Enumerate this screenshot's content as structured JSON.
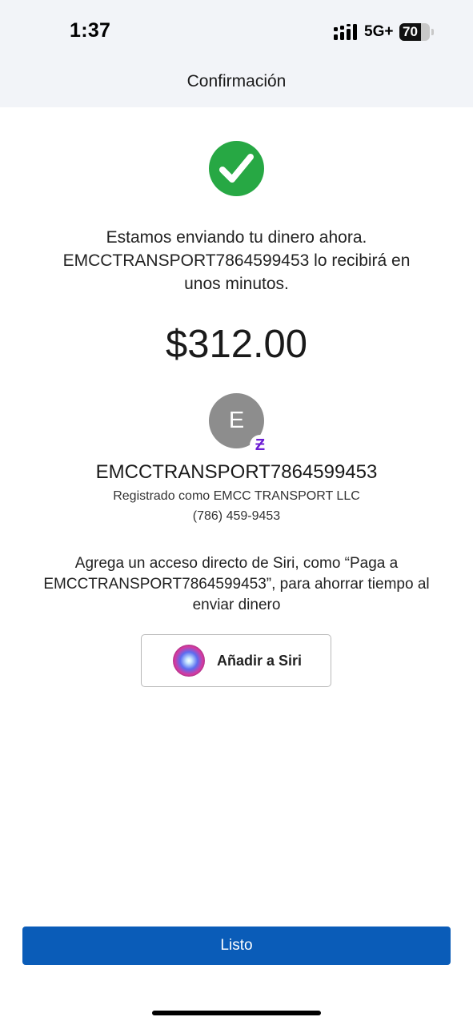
{
  "status_bar": {
    "time": "1:37",
    "network": "5G+",
    "battery": "70",
    "battery_level": 0.7,
    "icons": [
      "signal-icon",
      "battery-icon"
    ]
  },
  "header": {
    "title": "Confirmación"
  },
  "confirmation": {
    "icon": "check-circle-icon",
    "accent_color": "#27a844",
    "message_line1": "Estamos enviando tu dinero ahora.",
    "message_line2": "EMCCTRANSPORT7864599453 lo recibirá en",
    "message_line3": "unos minutos.",
    "amount": "$312.00"
  },
  "recipient": {
    "initial": "E",
    "badge_icon": "zelle-icon",
    "badge_glyph": "Ƶ",
    "badge_color": "#6d1ed4",
    "name": "EMCCTRANSPORT7864599453",
    "registered_as": "Registrado como EMCC TRANSPORT LLC",
    "phone": "(786) 459-9453"
  },
  "siri": {
    "text_line1": "Agrega un acceso directo de Siri, como “Paga a",
    "text_line2": "EMCCTRANSPORT7864599453”, para ahorrar tiempo al",
    "text_line3": "enviar dinero",
    "button_icon": "siri-icon",
    "button_label": "Añadir a Siri"
  },
  "footer": {
    "done_label": "Listo",
    "done_color": "#0a5cb8"
  }
}
